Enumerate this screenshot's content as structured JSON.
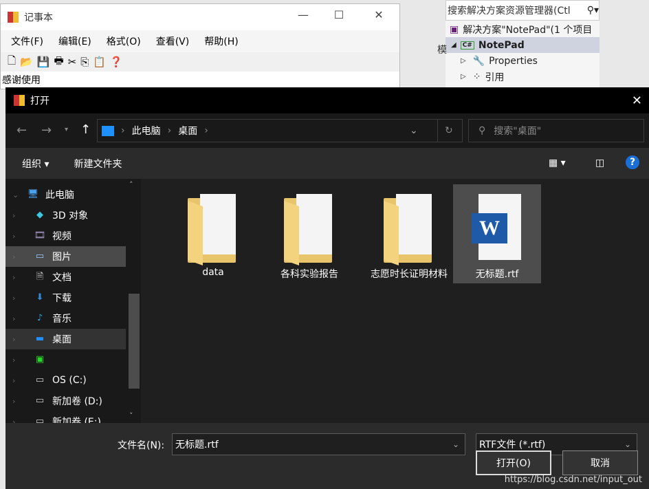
{
  "notepad": {
    "title": "记事本",
    "menu": [
      "文件(F)",
      "编辑(E)",
      "格式(O)",
      "查看(V)",
      "帮助(H)"
    ],
    "text": "感谢使用"
  },
  "vs": {
    "search_placeholder": "搜索解决方案资源管理器(Ctl",
    "solution": "解决方案\"NotePad\"(1 个项目",
    "project": "NotePad",
    "items": [
      "Properties",
      "引用"
    ],
    "partial": "模"
  },
  "dialog": {
    "title": "打开",
    "breadcrumb": [
      "此电脑",
      "桌面"
    ],
    "search_placeholder": "搜索\"桌面\"",
    "toolbar": {
      "organize": "组织",
      "new_folder": "新建文件夹"
    },
    "sidebar": [
      {
        "label": "此电脑",
        "icon": "computer-icon"
      },
      {
        "label": "3D 对象",
        "icon": "cube-icon"
      },
      {
        "label": "视频",
        "icon": "video-icon"
      },
      {
        "label": "图片",
        "icon": "pictures-icon",
        "selected": true
      },
      {
        "label": "文档",
        "icon": "document-icon"
      },
      {
        "label": "下载",
        "icon": "download-icon"
      },
      {
        "label": "音乐",
        "icon": "music-icon"
      },
      {
        "label": "桌面",
        "icon": "desktop-icon",
        "current": true
      },
      {
        "label": "",
        "icon": "app-icon"
      },
      {
        "label": "OS (C:)",
        "icon": "drive-icon"
      },
      {
        "label": "新加卷 (D:)",
        "icon": "drive-icon"
      },
      {
        "label": "新加卷 (E:)",
        "icon": "drive-icon"
      }
    ],
    "files": [
      {
        "name": "data",
        "type": "folder"
      },
      {
        "name": "各科实验报告",
        "type": "folder"
      },
      {
        "name": "志愿时长证明材料",
        "type": "folder"
      },
      {
        "name": "无标题.rtf",
        "type": "word",
        "selected": true
      }
    ],
    "filename_label": "文件名(N):",
    "filename_value": "无标题.rtf",
    "filetype": "RTF文件 (*.rtf)",
    "open_button": "打开(O)",
    "cancel_button": "取消",
    "watermark": "https://blog.csdn.net/input_out"
  }
}
